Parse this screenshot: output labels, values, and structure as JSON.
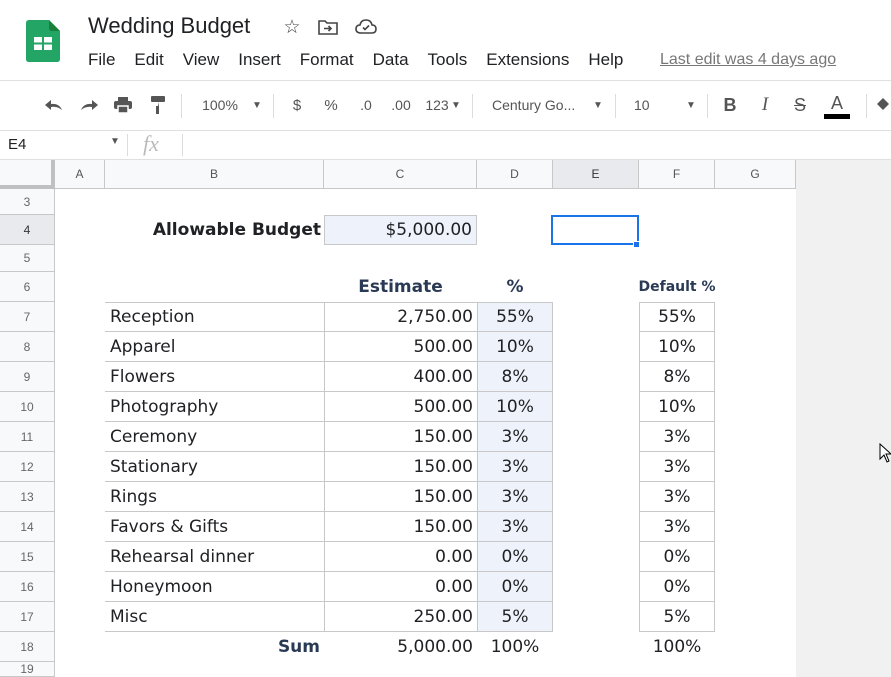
{
  "app": {
    "title": "Wedding Budget",
    "last_edit": "Last edit was 4 days ago",
    "menu": [
      "File",
      "Edit",
      "View",
      "Insert",
      "Format",
      "Data",
      "Tools",
      "Extensions",
      "Help"
    ]
  },
  "toolbar": {
    "zoom": "100%",
    "currency": "$",
    "percent": "%",
    "decrease_decimal": ".0",
    "increase_decimal": ".00",
    "number_format": "123",
    "font": "Century Go...",
    "font_size": "10",
    "bold": "B",
    "italic": "I",
    "strikethrough": "S",
    "text_color": "A"
  },
  "formula_bar": {
    "cell_ref": "E4",
    "fx": "fx",
    "value": ""
  },
  "columns": [
    "A",
    "B",
    "C",
    "D",
    "E",
    "F",
    "G"
  ],
  "rows": [
    "3",
    "4",
    "5",
    "6",
    "7",
    "8",
    "9",
    "10",
    "11",
    "12",
    "13",
    "14",
    "15",
    "16",
    "17",
    "18",
    "19"
  ],
  "sheet": {
    "budget_label": "Allowable Budget",
    "budget_value": "$5,000.00",
    "estimate_header": "Estimate",
    "pct_header": "%",
    "default_header": "Default %",
    "items": [
      {
        "name": "Reception",
        "estimate": "2,750.00",
        "pct": "55%",
        "default": "55%"
      },
      {
        "name": "Apparel",
        "estimate": "500.00",
        "pct": "10%",
        "default": "10%"
      },
      {
        "name": "Flowers",
        "estimate": "400.00",
        "pct": "8%",
        "default": "8%"
      },
      {
        "name": "Photography",
        "estimate": "500.00",
        "pct": "10%",
        "default": "10%"
      },
      {
        "name": "Ceremony",
        "estimate": "150.00",
        "pct": "3%",
        "default": "3%"
      },
      {
        "name": "Stationary",
        "estimate": "150.00",
        "pct": "3%",
        "default": "3%"
      },
      {
        "name": "Rings",
        "estimate": "150.00",
        "pct": "3%",
        "default": "3%"
      },
      {
        "name": "Favors & Gifts",
        "estimate": "150.00",
        "pct": "3%",
        "default": "3%"
      },
      {
        "name": "Rehearsal dinner",
        "estimate": "0.00",
        "pct": "0%",
        "default": "0%"
      },
      {
        "name": "Honeymoon",
        "estimate": "0.00",
        "pct": "0%",
        "default": "0%"
      },
      {
        "name": "Misc",
        "estimate": "250.00",
        "pct": "5%",
        "default": "5%"
      }
    ],
    "sum_label": "Sum",
    "sum_estimate": "5,000.00",
    "sum_pct": "100%",
    "sum_default": "100%"
  },
  "colors": {
    "selection": "#1a73e8",
    "input_fill": "#eef3fb",
    "header_text": "#2a3a55",
    "brand_green": "#0f9d58"
  }
}
